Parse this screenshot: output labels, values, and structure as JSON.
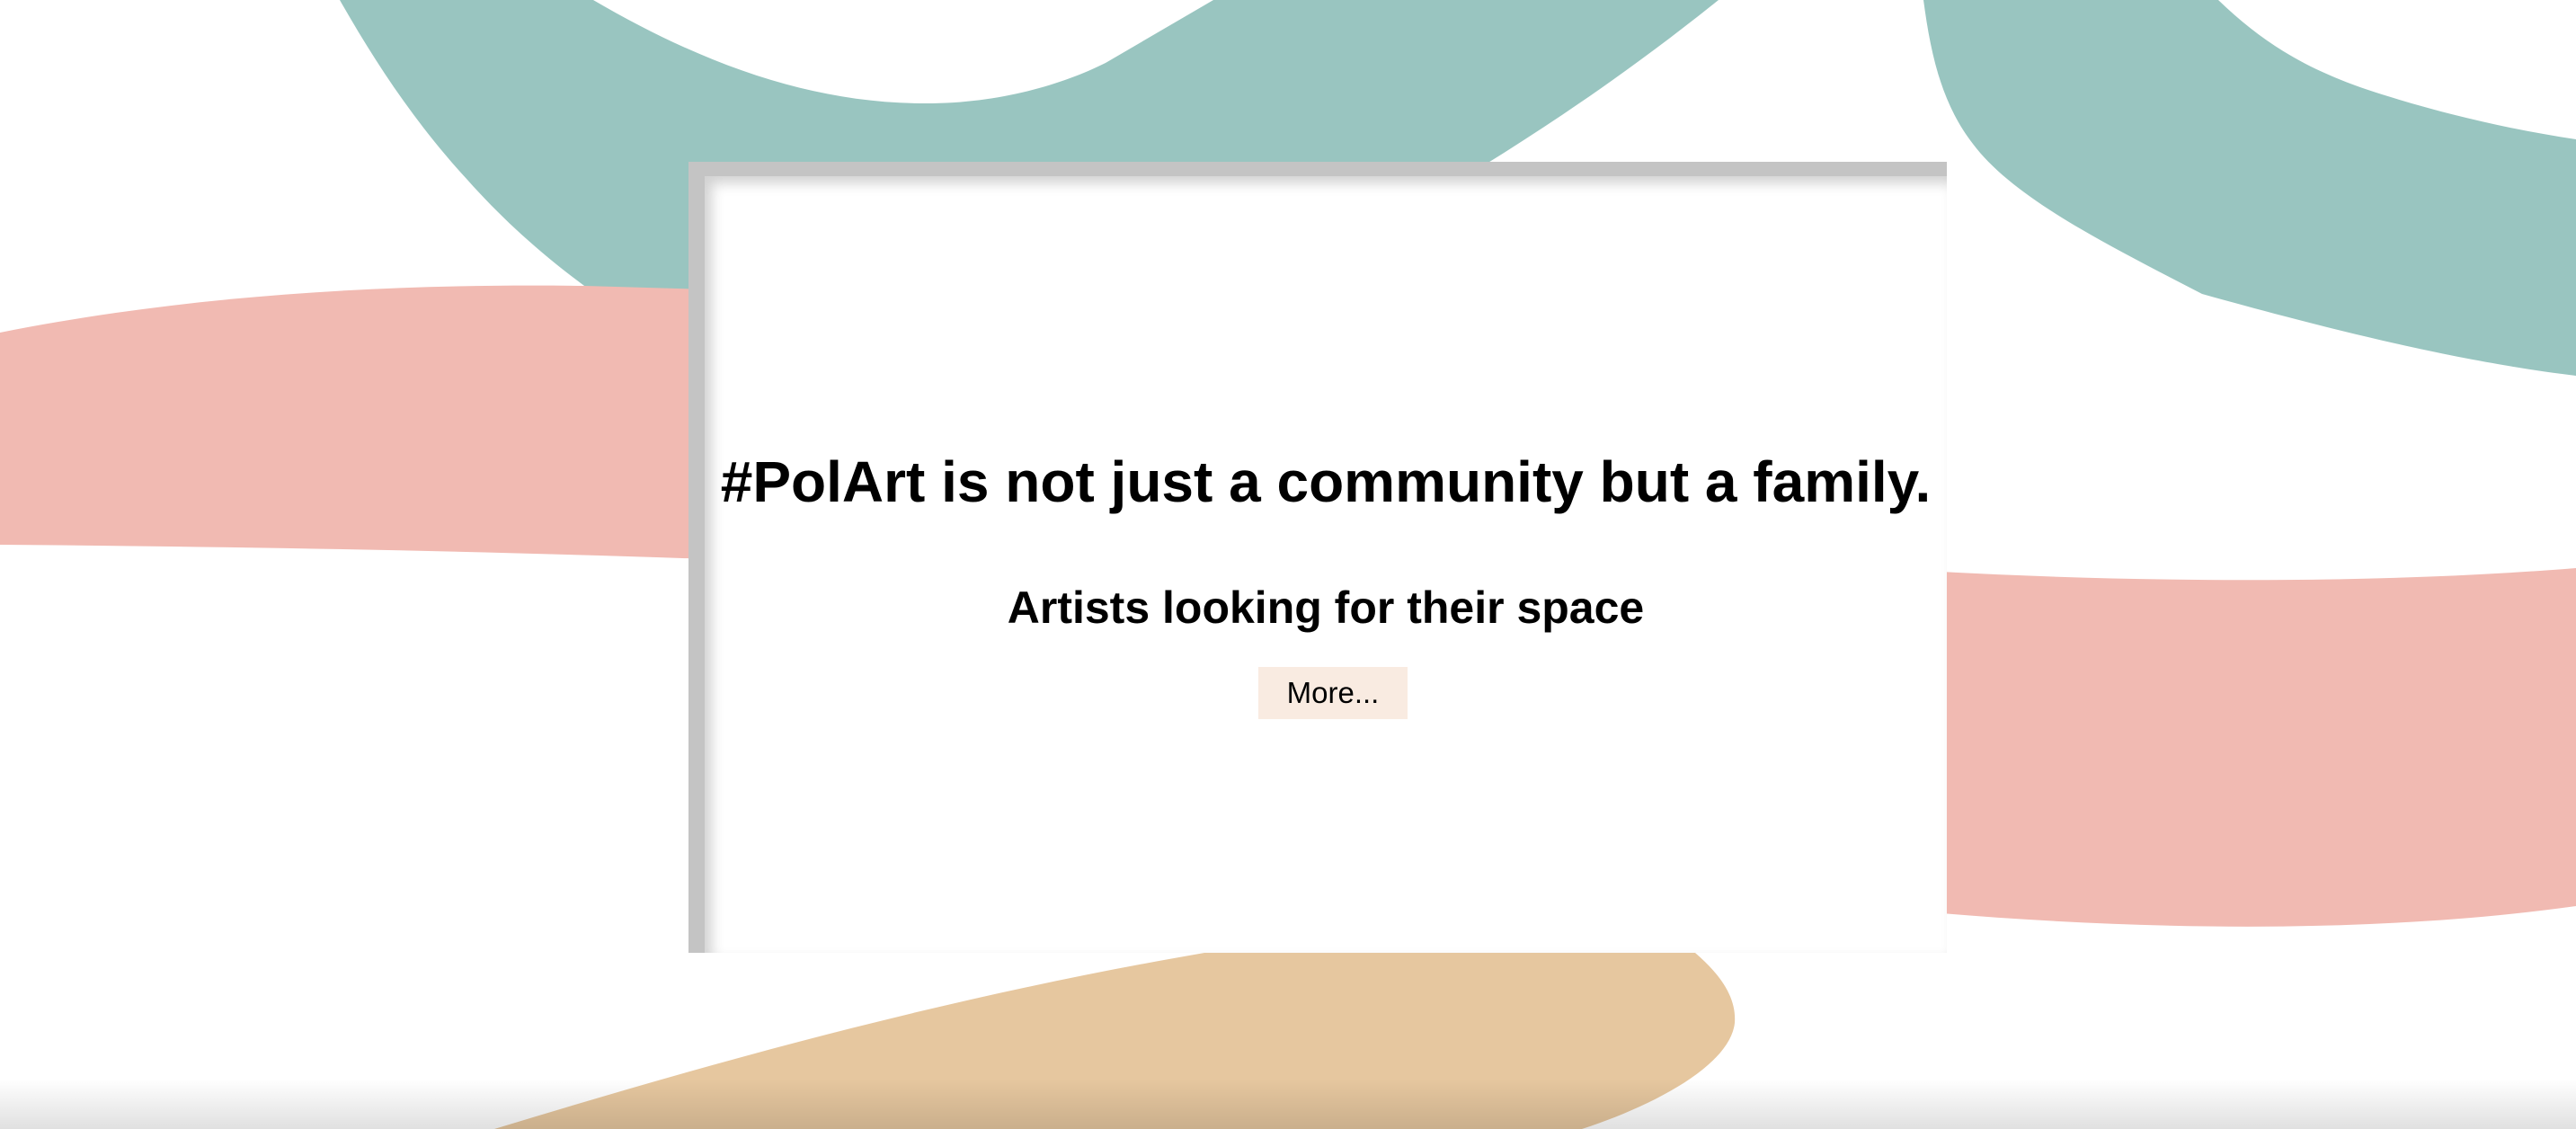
{
  "hero": {
    "title": "#PolArt is not just a community but a family.",
    "subtitle": "Artists looking for their space",
    "more_button_label": "More..."
  },
  "colors": {
    "teal_shape": "#99c5c0",
    "pink_shape": "#f1bab2",
    "tan_shape": "#e6c79f",
    "card_border": "#c4c4c4",
    "button_bg": "#f9ebe1"
  }
}
